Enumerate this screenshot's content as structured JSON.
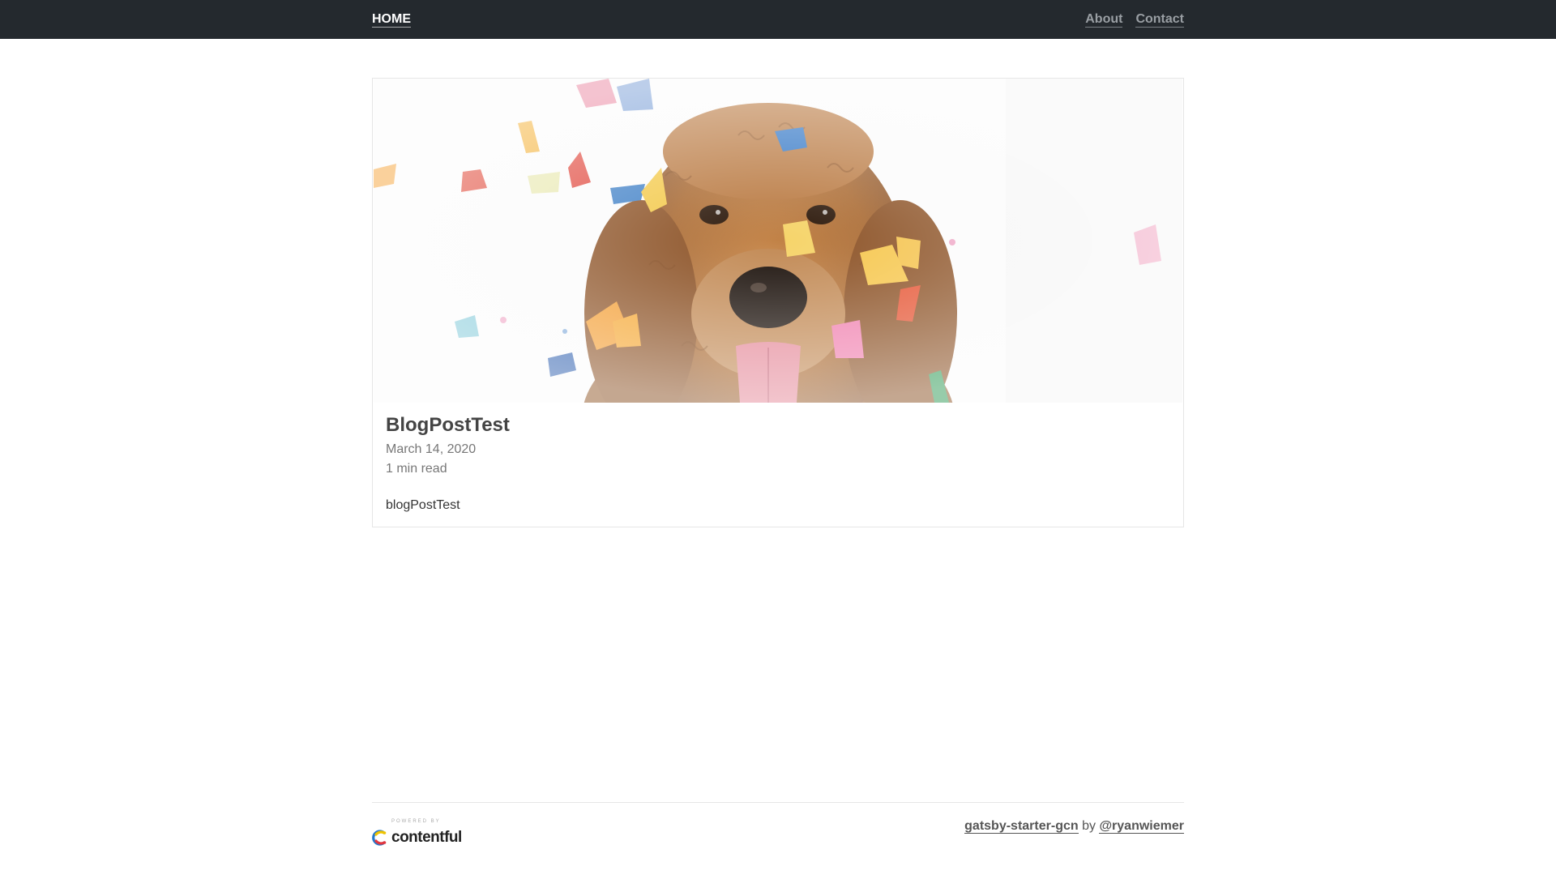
{
  "nav": {
    "home_label": "HOME",
    "links": [
      {
        "label": "About"
      },
      {
        "label": "Contact"
      }
    ]
  },
  "post": {
    "title": "BlogPostTest",
    "date": "March 14, 2020",
    "read_time": "1 min read",
    "excerpt": "blogPostTest",
    "hero_image": "dog-with-confetti-photo"
  },
  "footer": {
    "powered_by_small": "POWERED BY",
    "powered_by_brand": "contentful",
    "credit_project": "gatsby-starter-gcn",
    "credit_by": "by",
    "credit_author": "@ryanwiemer"
  },
  "colors": {
    "topbar_bg": "#24292e",
    "text": "#333333",
    "muted": "#777777",
    "border": "#e6e6e6"
  }
}
